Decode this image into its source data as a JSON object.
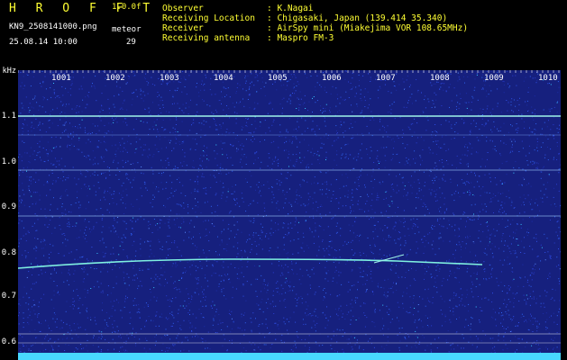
{
  "header": {
    "brand": "H R O F F T",
    "version": "1.0.0f",
    "filename": "KN9_2508141000.png",
    "site_code": "meteor",
    "datetime": "25.08.14 10:00",
    "count": "29",
    "info": [
      {
        "label": "Observer",
        "value": ": K.Nagai"
      },
      {
        "label": "Receiving Location",
        "value": ": Chigasaki, Japan (139.414 35.340)"
      },
      {
        "label": "Receiver",
        "value": ": AirSpy mini (Miakejima VOR 108.65MHz)"
      },
      {
        "label": "Receiving antenna",
        "value": ": Maspro FM-3"
      }
    ]
  },
  "colors": {
    "background": "#16207e",
    "text_yellow": "#ffff33",
    "trace": "#7ff0e0",
    "noise_bright": "#38c8ff"
  },
  "axis": {
    "y_unit": "kHz",
    "y_ticks": [
      "1.1",
      "1.0",
      "0.9",
      "0.8",
      "0.7",
      "0.6"
    ],
    "x_ticks": [
      "1001",
      "1002",
      "1003",
      "1004",
      "1005",
      "1006",
      "1007",
      "1008",
      "1009",
      "1010"
    ]
  }
}
